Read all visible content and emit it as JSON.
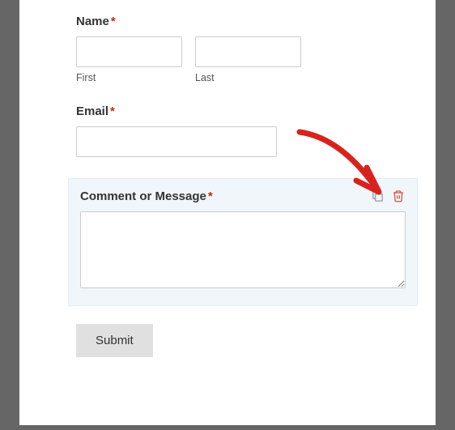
{
  "fields": {
    "name": {
      "label": "Name",
      "required": "*",
      "first_sub": "First",
      "last_sub": "Last"
    },
    "email": {
      "label": "Email",
      "required": "*"
    },
    "comment": {
      "label": "Comment or Message",
      "required": "*"
    }
  },
  "submit_label": "Submit",
  "colors": {
    "required": "#c02b0a",
    "selected_bg": "#f1f6fa",
    "accent_arrow": "#d8231d"
  }
}
